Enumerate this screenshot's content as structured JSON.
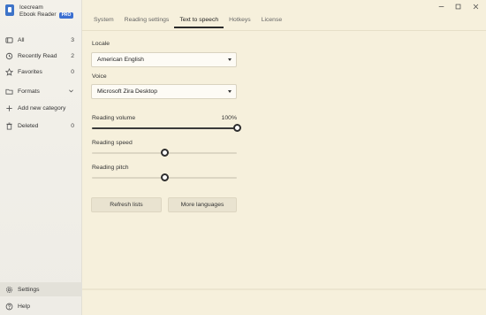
{
  "app": {
    "brand_line1": "Icecream",
    "brand_line2": "Ebook Reader",
    "badge": "PRO"
  },
  "sidebar": {
    "items": [
      {
        "label": "All",
        "count": "3",
        "icon": "grid-icon"
      },
      {
        "label": "Recently Read",
        "count": "2",
        "icon": "history-icon"
      },
      {
        "label": "Favorites",
        "count": "0",
        "icon": "star-icon"
      },
      {
        "label": "Formats",
        "icon": "folder-icon",
        "chevron": "chevron-down-icon"
      },
      {
        "label": "Add new category",
        "icon": "plus-icon"
      },
      {
        "label": "Deleted",
        "count": "0",
        "icon": "trash-icon"
      }
    ],
    "bottom": [
      {
        "label": "Settings",
        "icon": "gear-icon"
      },
      {
        "label": "Help",
        "icon": "help-icon"
      }
    ]
  },
  "tabs": [
    {
      "label": "System"
    },
    {
      "label": "Reading settings"
    },
    {
      "label": "Text to speech",
      "active": true
    },
    {
      "label": "Hotkeys"
    },
    {
      "label": "License"
    }
  ],
  "tts": {
    "locale_label": "Locale",
    "locale_value": "American English",
    "voice_label": "Voice",
    "voice_value": "Microsoft Zira Desktop",
    "volume_label": "Reading volume",
    "volume_value_text": "100%",
    "volume_fraction": 1.0,
    "speed_label": "Reading speed",
    "speed_fraction": 0.5,
    "pitch_label": "Reading pitch",
    "pitch_fraction": 0.5,
    "refresh_button": "Refresh lists",
    "more_languages_button": "More languages"
  },
  "colors": {
    "background": "#f6f0dc",
    "sidebar": "#f1efe8",
    "accent": "#3b6fd1"
  }
}
